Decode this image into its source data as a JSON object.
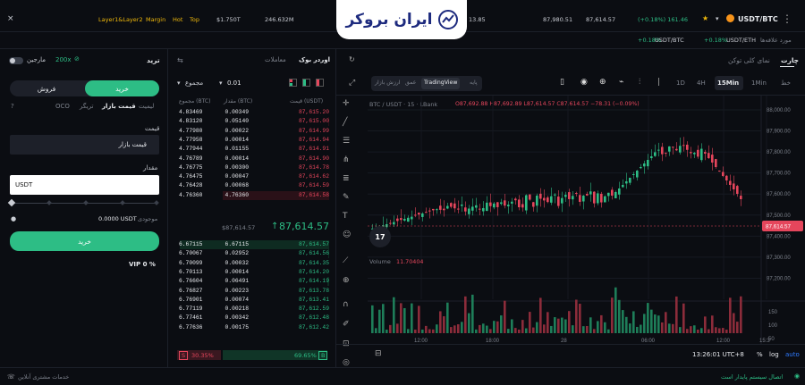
{
  "ticker": {
    "items": [
      "Layer1&Layer2",
      "Margin",
      "Hot",
      "Top"
    ],
    "stat1": "$1.750T",
    "stat2": "246.632M",
    "stat3": "13.85",
    "price1": "87,980.51",
    "price2": "87,614.57",
    "change": "(+0.18%) 161.46",
    "pair": "USDT/BTC",
    "close": "×"
  },
  "favorites": {
    "label": "مورد علاقه‌ها",
    "items": [
      {
        "change": "+0.18%",
        "pair": "USDT/BTC"
      },
      {
        "change": "+0.18%",
        "pair": "USDT/ETH"
      }
    ]
  },
  "brand": {
    "name": "ایران بروکر"
  },
  "chart_panel": {
    "tabs": [
      "چارت",
      "نمای کلی توکن"
    ],
    "time_buttons": [
      "خط",
      "1Min",
      "15Min",
      "4H",
      "1D"
    ],
    "active_time": "15Min",
    "view_tabs": [
      "پایه",
      "TradingView",
      "عمق",
      "ارزش بازار"
    ],
    "symbol_line": "BTC / USDT · 15 · LBank",
    "ohlc": "O87,692.88  H87,692.89  L87,614.57  C87,614.57  −78.31 (−0.09%)",
    "price_axis": [
      "88,000.00",
      "87,900.00",
      "87,800.00",
      "87,700.00",
      "87,600.00",
      "87,500.00",
      "87,400.00",
      "87,300.00",
      "87,200.00"
    ],
    "current_price_tag": "87,614.57",
    "volume_label": "Volume",
    "volume_value": "11.70404",
    "vol_axis": [
      "150",
      "100",
      "50"
    ],
    "time_axis": [
      "12:00",
      "18:00",
      "28",
      "06:00",
      "12:00",
      "15:3"
    ],
    "clock": "13:26:01 UTC+8",
    "scale_opts": [
      "%",
      "log",
      "auto"
    ],
    "tv_logo": "17"
  },
  "orderbook": {
    "tabs": [
      "اوردر بوک",
      "معاملات"
    ],
    "precision": "0.01",
    "group_label": "مجموع",
    "headers": [
      "قیمت (USDT)",
      "مقدار (BTC)",
      "مجموع (BTC)"
    ],
    "asks": [
      [
        "87,615.20",
        "0.00349",
        "4.83469"
      ],
      [
        "87,615.00",
        "0.05140",
        "4.83120"
      ],
      [
        "87,614.99",
        "0.00022",
        "4.77980"
      ],
      [
        "87,614.94",
        "0.00014",
        "4.77958"
      ],
      [
        "87,614.91",
        "0.01155",
        "4.77944"
      ],
      [
        "87,614.90",
        "0.00014",
        "4.76789"
      ],
      [
        "87,614.78",
        "0.00300",
        "4.76775"
      ],
      [
        "87,614.62",
        "0.00047",
        "4.76475"
      ],
      [
        "87,614.59",
        "0.00068",
        "4.76428"
      ],
      [
        "87,614.58",
        "4.76360",
        "4.76360"
      ]
    ],
    "mid_price": "87,614.57",
    "mid_sub": "$87,614.57",
    "bids": [
      [
        "87,614.57",
        "6.67115",
        "6.67115"
      ],
      [
        "87,614.56",
        "0.02952",
        "6.70067"
      ],
      [
        "87,614.35",
        "0.00032",
        "6.70099"
      ],
      [
        "87,614.20",
        "0.00014",
        "6.70113"
      ],
      [
        "87,614.19",
        "0.06491",
        "6.76604"
      ],
      [
        "87,613.78",
        "0.00223",
        "6.76827"
      ],
      [
        "87,613.41",
        "0.00074",
        "6.76901"
      ],
      [
        "87,612.59",
        "0.00218",
        "6.77119"
      ],
      [
        "87,612.48",
        "0.00342",
        "6.77461"
      ],
      [
        "87,612.42",
        "0.00175",
        "6.77636"
      ]
    ],
    "buy_ratio": "69.65%",
    "sell_ratio": "30.35%",
    "buy_letter": "B",
    "sell_letter": "S",
    "buy_ratio_value": 69.65
  },
  "trade": {
    "title": "ترید",
    "margin_label": "مارجین",
    "leverage": "200x",
    "buy": "خرید",
    "sell": "فروش",
    "order_types": [
      "لیمیت",
      "قیمت بازار",
      "تریگر",
      "OCO"
    ],
    "active_order_type": "قیمت بازار",
    "price_label": "قیمت",
    "price_value": "قیمت بازار",
    "amount_label": "مقدار",
    "amount_currency": "USDT",
    "available_label": "موجودی",
    "available_value": "0.0000 USDT",
    "submit": "خرید",
    "vip": "VIP 0 %"
  },
  "footer": {
    "support": "خدمات مشتری آنلاین",
    "status": "اتصال سیستم پایدار است"
  },
  "colors": {
    "green": "#2dbd85",
    "red": "#e5465c",
    "accent": "#f0b90b",
    "bg": "#0b0d12"
  }
}
